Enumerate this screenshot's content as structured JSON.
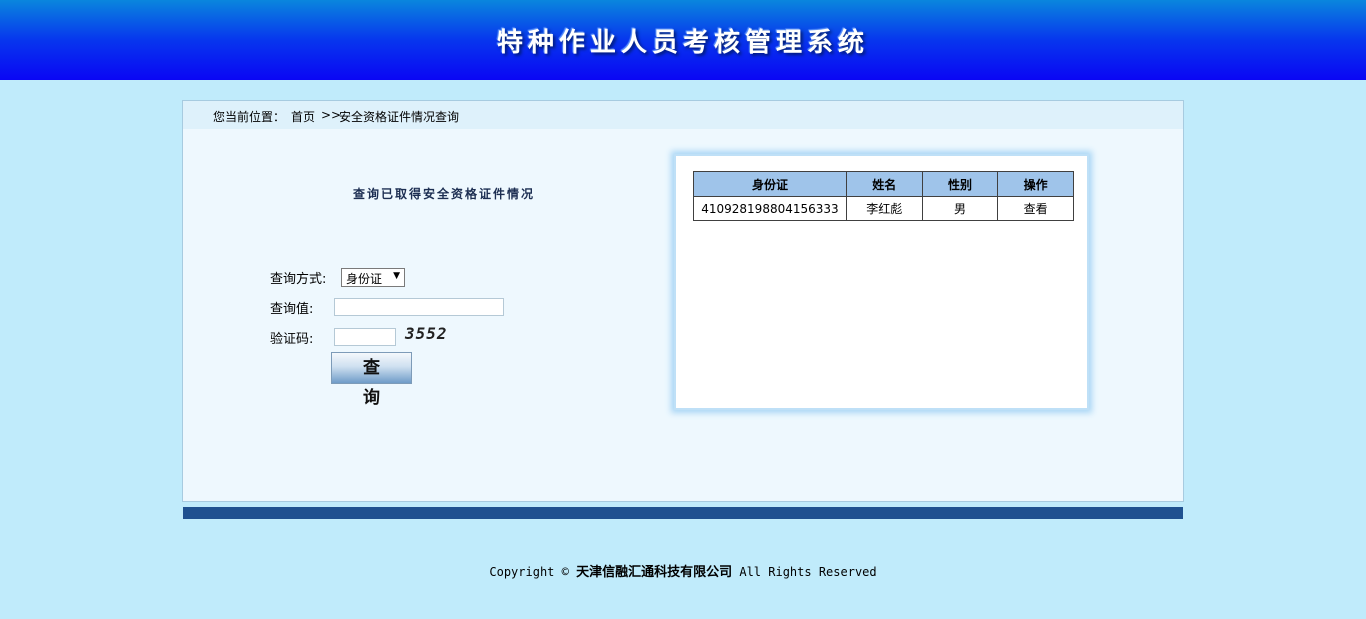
{
  "header": {
    "title": "特种作业人员考核管理系统"
  },
  "breadcrumb": {
    "prefix": "您当前位置：",
    "home": "首页",
    "separator": ">>",
    "current": "安全资格证件情况查询"
  },
  "form": {
    "title": "查询已取得安全资格证件情况",
    "mode_label": "查询方式:",
    "mode_value": "身份证",
    "value_label": "查询值:",
    "value": "",
    "captcha_label": "验证码:",
    "captcha_value": "",
    "captcha_image_text": "3552",
    "submit_label": "查 询"
  },
  "results": {
    "columns": [
      "身份证",
      "姓名",
      "性别",
      "操作"
    ],
    "rows": [
      [
        "410928198804156333",
        "李红彪",
        "男",
        "查看"
      ]
    ]
  },
  "footer": {
    "pre": "Copyright ©",
    "company": "天津信融汇通科技有限公司",
    "post": "All Rights Reserved"
  },
  "colors": {
    "background": "#c0ebfb",
    "header_top": "#0a86dd",
    "header_bottom": "#0a06f4",
    "table_header": "#9fc4ea",
    "bottom_bar": "#1f5190"
  }
}
